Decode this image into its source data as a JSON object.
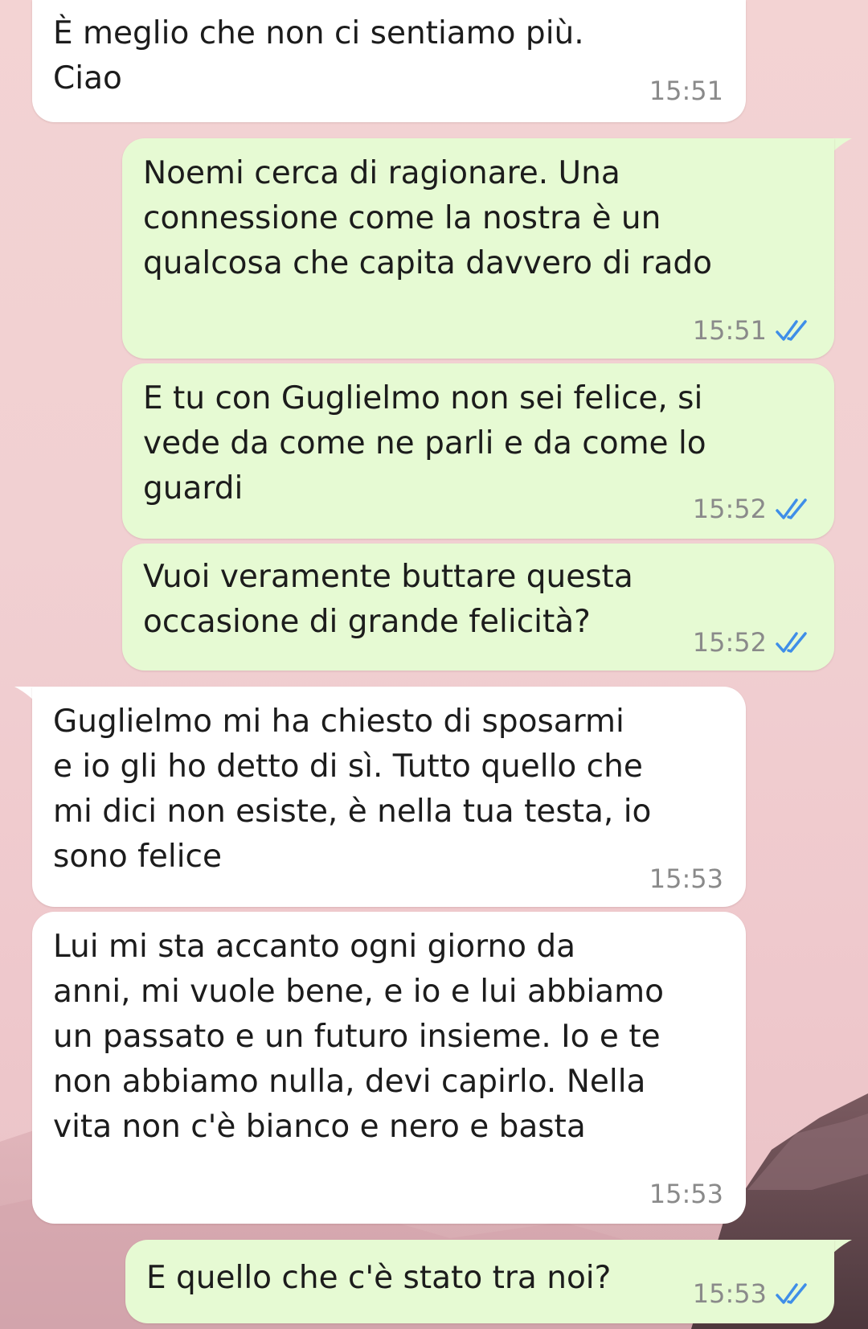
{
  "messages": [
    {
      "direction": "incoming",
      "text": "È meglio che non ci sentiamo più.\nCiao",
      "time": "15:51"
    },
    {
      "direction": "outgoing",
      "text": "Noemi cerca di ragionare. Una\nconnessione come la nostra è un\nqualcosa che capita davvero di rado",
      "time": "15:51",
      "status": "read",
      "status_icon": "double-check-icon"
    },
    {
      "direction": "outgoing",
      "text": "E tu con Guglielmo non sei felice, si\nvede da come ne parli e da come lo\nguardi",
      "time": "15:52",
      "status": "read",
      "status_icon": "double-check-icon"
    },
    {
      "direction": "outgoing",
      "text": "Vuoi veramente buttare questa\noccasione di grande felicità?",
      "time": "15:52",
      "status": "read",
      "status_icon": "double-check-icon"
    },
    {
      "direction": "incoming",
      "text": "Guglielmo mi ha chiesto di sposarmi\ne io gli ho detto di sì. Tutto quello che\nmi dici non esiste, è nella tua testa, io\nsono felice",
      "time": "15:53"
    },
    {
      "direction": "incoming",
      "text": "Lui mi sta accanto ogni giorno da\nanni, mi vuole bene, e io e lui abbiamo\nun passato e un futuro insieme. Io e te\nnon abbiamo nulla, devi capirlo. Nella\nvita non c'è bianco e nero e basta",
      "time": "15:53"
    },
    {
      "direction": "outgoing",
      "text": "E quello che c'è stato tra noi?",
      "time": "15:53",
      "status": "read",
      "status_icon": "double-check-icon"
    }
  ],
  "colors": {
    "incoming_bubble": "#ffffff",
    "outgoing_bubble": "#e6fad3",
    "read_ticks": "#3f8ee8",
    "timestamp": "#8a8a8a",
    "wallpaper": "#f1d0d2"
  }
}
